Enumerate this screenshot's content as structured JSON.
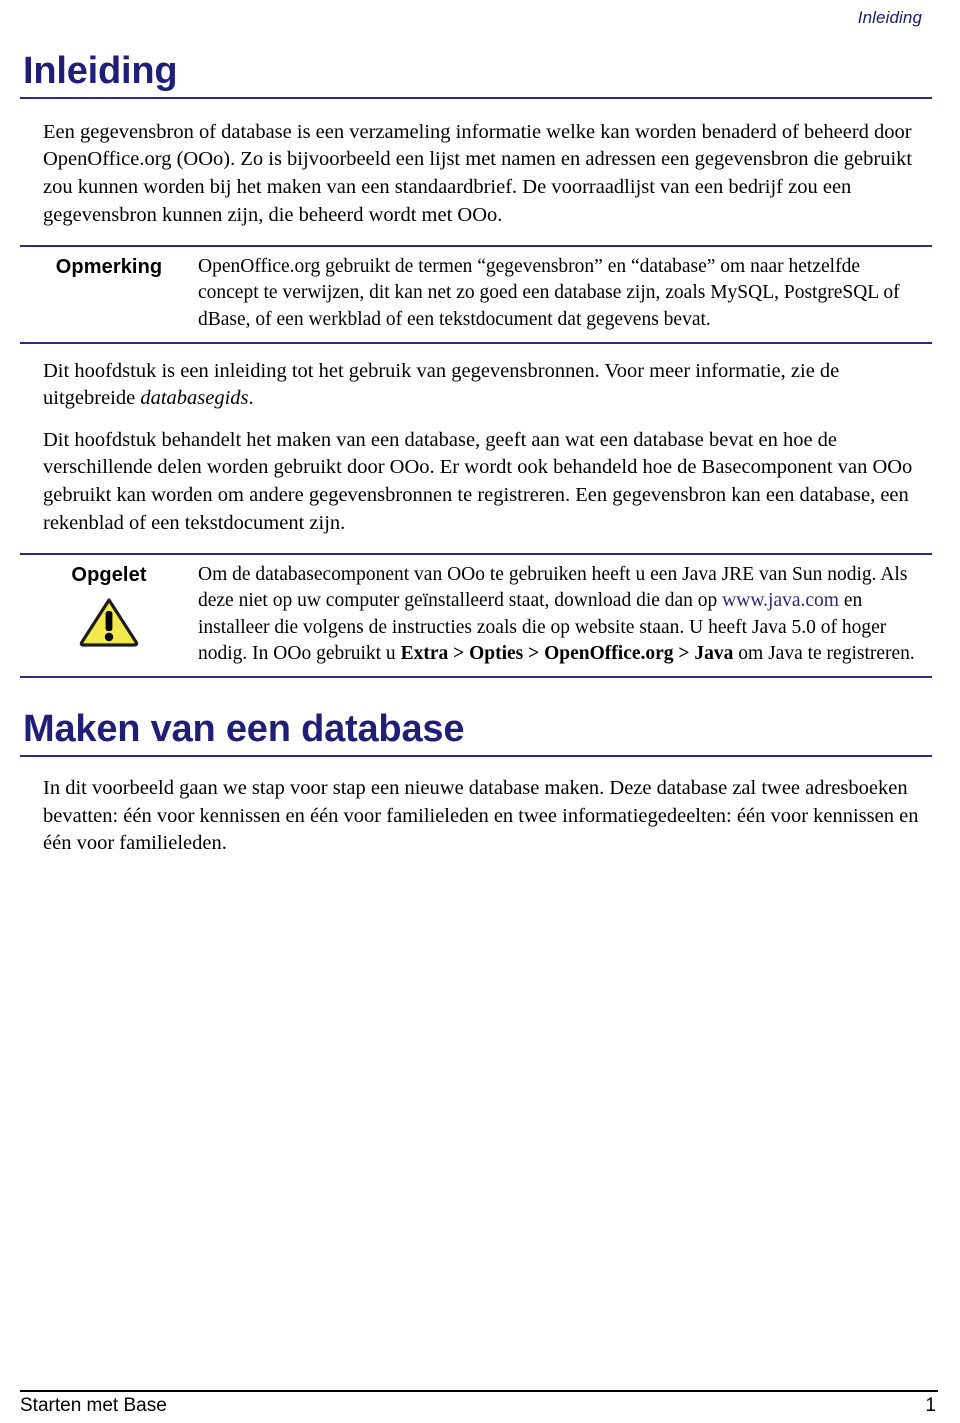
{
  "header": {
    "running_title": "Inleiding"
  },
  "headings": {
    "h1_intro": "Inleiding",
    "h1_create_db": "Maken van een database"
  },
  "paragraphs": {
    "intro": "Een gegevensbron of database is een verzameling informatie welke kan worden benaderd of beheerd door OpenOffice.org (OOo). Zo is bijvoorbeeld een lijst met namen en adressen een gegevensbron die gebruikt zou kunnen worden bij het maken van een standaardbrief. De voorraadlijst van een bedrijf zou een gegevensbron kunnen zijn, die beheerd wordt met OOo.",
    "chapter_intro_a": "Dit hoofdstuk is een inleiding tot het gebruik van gegevensbronnen. Voor meer informatie, zie de uitgebreide ",
    "chapter_intro_italic": "databasegids",
    "chapter_intro_b": ".",
    "chapter_scope": "Dit hoofdstuk behandelt het maken van een database, geeft aan wat een database bevat en hoe de verschillende delen worden gebruikt door OOo. Er wordt ook behandeld hoe de Basecomponent van OOo gebruikt kan worden om andere gegevensbronnen te registreren. Een gegevensbron kan een database, een rekenblad of een tekstdocument zijn.",
    "example": "In dit voorbeeld gaan we stap voor stap een nieuwe database maken. Deze database zal twee adresboeken bevatten: één voor kennissen en één voor familieleden en twee informatiegedeelten: één voor kennissen en één voor familieleden."
  },
  "note_box": {
    "label": "Opmerking",
    "text": "OpenOffice.org gebruikt de termen “gegevensbron” en “database” om naar hetzelfde concept te verwijzen, dit kan net zo goed een database zijn, zoals MySQL, PostgreSQL of dBase, of een werkblad of een tekstdocument dat gegevens bevat."
  },
  "warning_box": {
    "label": "Opgelet",
    "icon": "warning-triangle-icon",
    "text_1": "Om de databasecomponent van OOo te gebruiken heeft u een Java JRE van Sun nodig. Als deze niet op uw computer geïnstalleerd staat, download die dan op ",
    "link": "www.java.com",
    "text_2": " en installeer die volgens de instructies zoals die op website staan. U heeft Java 5.0 of hoger nodig. In OOo gebruikt u ",
    "menu_path": "Extra > Opties > OpenOffice.org > Java",
    "text_3": " om Java te registreren."
  },
  "footer": {
    "document_title": "Starten met Base",
    "page_number": "1"
  },
  "colors": {
    "heading_navy": "#1f1f7a",
    "rule_navy": "#2b2b86",
    "link_navy": "#27277e",
    "warning_yellow": "#F2E94B",
    "warning_outline": "#1c1c1c",
    "footer_rule": "#000000"
  }
}
